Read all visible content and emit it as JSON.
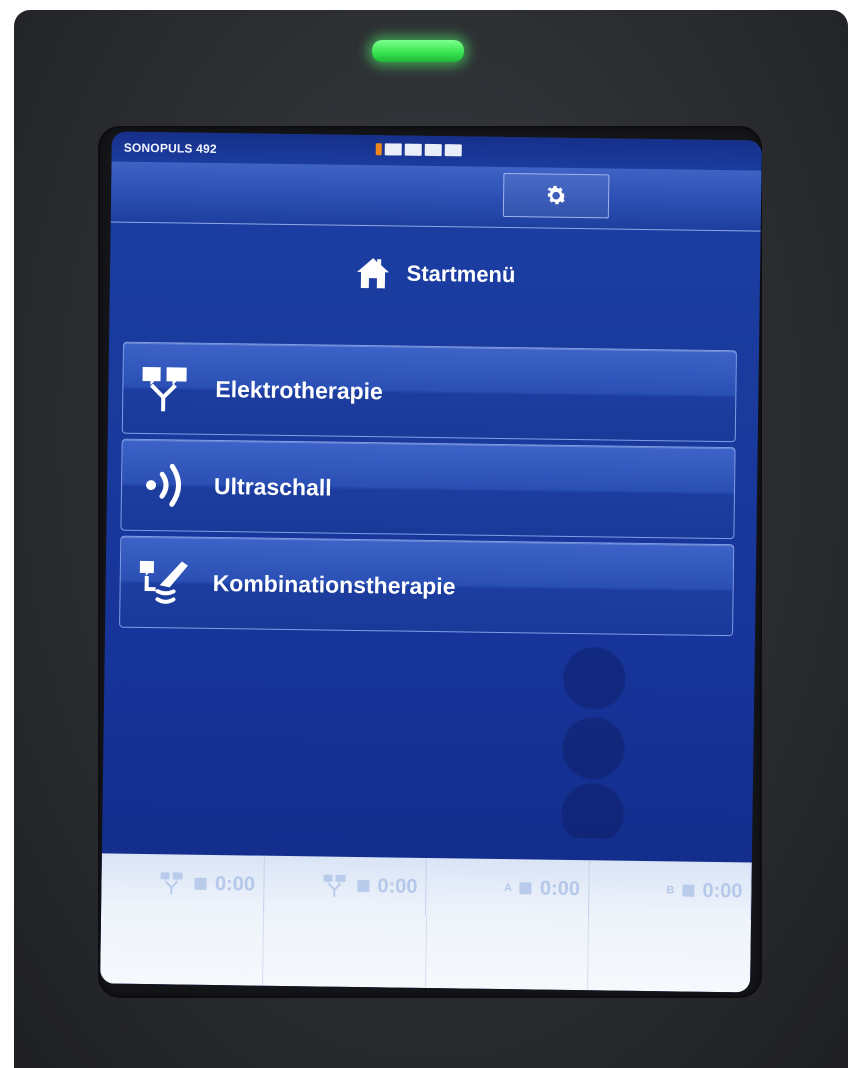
{
  "device": {
    "name": "SONOPULS 492"
  },
  "status": {
    "progress_segments": 5,
    "active_segment": 0,
    "accent_color": "#f0861e"
  },
  "toolbar": {
    "settings_icon": "gear-icon"
  },
  "header": {
    "icon": "home-icon",
    "title": "Startmenü"
  },
  "menu": {
    "items": [
      {
        "label": "Elektrotherapie",
        "icon": "electrode-icon"
      },
      {
        "label": "Ultraschall",
        "icon": "ultrasound-waves-icon"
      },
      {
        "label": "Kombinationstherapie",
        "icon": "combination-probe-icon"
      }
    ]
  },
  "timers": [
    {
      "label": "",
      "icon": "electrode-channel-1-icon",
      "value": "0:00"
    },
    {
      "label": "",
      "icon": "electrode-channel-2-icon",
      "value": "0:00"
    },
    {
      "label": "A",
      "icon": "",
      "value": "0:00"
    },
    {
      "label": "B",
      "icon": "",
      "value": "0:00"
    }
  ],
  "colors": {
    "screen_blue": "#1a3a9c",
    "led_green": "#35e24e",
    "timer_panel": "#eef3fb"
  }
}
